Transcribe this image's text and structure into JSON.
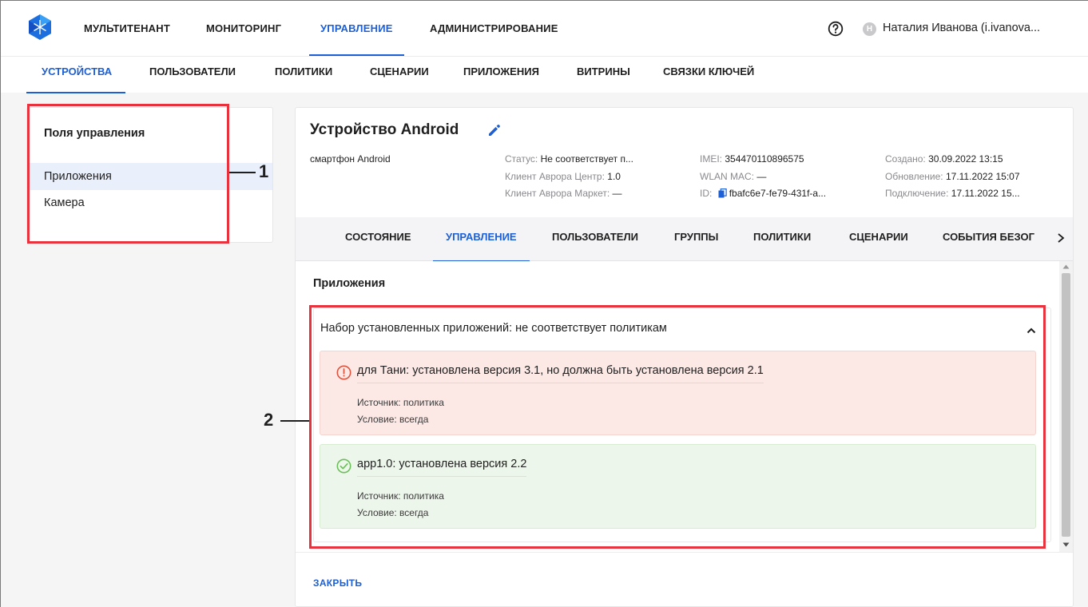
{
  "top_nav": {
    "items": [
      {
        "label": "МУЛЬТИТЕНАНТ",
        "active": false
      },
      {
        "label": "МОНИТОРИНГ",
        "active": false
      },
      {
        "label": "УПРАВЛЕНИЕ",
        "active": true
      },
      {
        "label": "АДМИНИСТРИРОВАНИЕ",
        "active": false
      }
    ],
    "help_icon": "question-circle-icon",
    "user": {
      "initial": "Н",
      "name": "Наталия Иванова (i.ivanova..."
    }
  },
  "sub_nav": {
    "items": [
      {
        "label": "УСТРОЙСТВА",
        "active": true
      },
      {
        "label": "ПОЛЬЗОВАТЕЛИ",
        "active": false
      },
      {
        "label": "ПОЛИТИКИ",
        "active": false
      },
      {
        "label": "СЦЕНАРИИ",
        "active": false
      },
      {
        "label": "ПРИЛОЖЕНИЯ",
        "active": false
      },
      {
        "label": "ВИТРИНЫ",
        "active": false
      },
      {
        "label": "СВЯЗКИ КЛЮЧЕЙ",
        "active": false
      }
    ]
  },
  "left_panel": {
    "title": "Поля управления",
    "items": [
      {
        "label": "Приложения",
        "selected": true
      },
      {
        "label": "Камера",
        "selected": false
      }
    ]
  },
  "annotations": {
    "one": "1",
    "two": "2",
    "color": "#e8323e"
  },
  "device": {
    "title": "Устройство Android",
    "type": "смартфон Android",
    "status_label": "Статус:",
    "status_value": "Не соответствует п...",
    "client_center_label": "Клиент Аврора Центр:",
    "client_center_value": "1.0",
    "client_market_label": "Клиент Аврора Маркет:",
    "client_market_value": "—",
    "imei_label": "IMEI:",
    "imei_value": "354470110896575",
    "wlan_label": "WLAN MAC:",
    "wlan_value": "—",
    "id_label": "ID:",
    "id_value": "fbafc6e7-fe79-431f-a...",
    "created_label": "Создано:",
    "created_value": "30.09.2022 13:15",
    "updated_label": "Обновление:",
    "updated_value": "17.11.2022 15:07",
    "connected_label": "Подключение:",
    "connected_value": "17.11.2022 15..."
  },
  "tabs": [
    {
      "label": "СОСТОЯНИЕ",
      "active": false
    },
    {
      "label": "УПРАВЛЕНИЕ",
      "active": true
    },
    {
      "label": "ПОЛЬЗОВАТЕЛИ",
      "active": false
    },
    {
      "label": "ГРУППЫ",
      "active": false
    },
    {
      "label": "ПОЛИТИКИ",
      "active": false
    },
    {
      "label": "СЦЕНАРИИ",
      "active": false
    },
    {
      "label": "СОБЫТИЯ БЕЗОГ",
      "active": false
    }
  ],
  "content": {
    "section_title": "Приложения",
    "accordion_header": "Набор установленных приложений: не соответствует политикам",
    "entries": [
      {
        "status": "error",
        "icon": "alert-circle-icon",
        "title": "для Тани: установлена версия 3.1, но должна быть установлена версия 2.1",
        "source": "Источник: политика",
        "condition": "Условие: всегда"
      },
      {
        "status": "ok",
        "icon": "check-circle-icon",
        "title": "app1.0: установлена версия 2.2",
        "source": "Источник: политика",
        "condition": "Условие: всегда"
      }
    ]
  },
  "footer": {
    "close_label": "ЗАКРЫТЬ"
  },
  "colors": {
    "accent": "#1c5fd6",
    "error_bg": "#fce8e5",
    "ok_bg": "#edf6ea",
    "annotation": "#e8323e"
  }
}
